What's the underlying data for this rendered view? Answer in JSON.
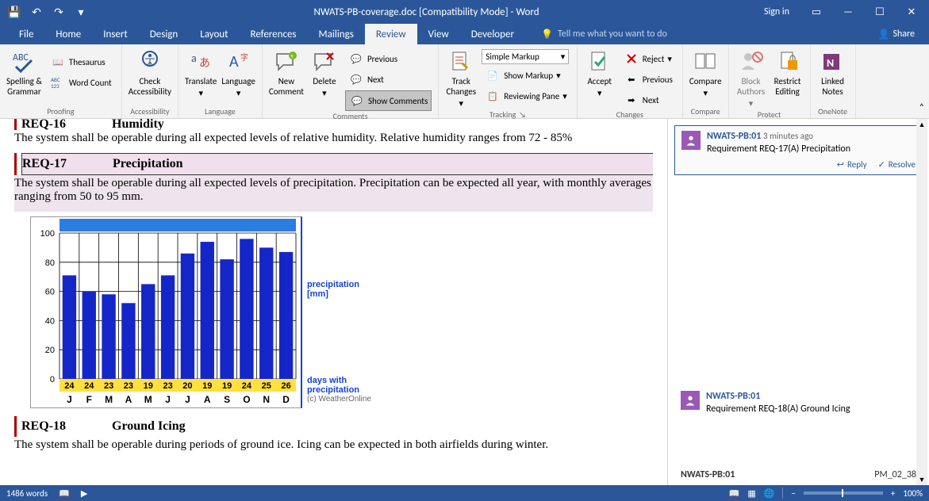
{
  "titlebar": {
    "title": "NWATS-PB-coverage.doc [Compatibility Mode] - Word",
    "signin": "Sign in"
  },
  "tabs": [
    "File",
    "Home",
    "Insert",
    "Design",
    "Layout",
    "References",
    "Mailings",
    "Review",
    "View",
    "Developer"
  ],
  "tellme": "Tell me what you want to do",
  "share": "Share",
  "ribbon": {
    "proofing": {
      "spelling": "Spelling &\nGrammar",
      "thesaurus": "Thesaurus",
      "wordcount": "Word Count",
      "label": "Proofing"
    },
    "accessibility": {
      "check": "Check\nAccessibility",
      "label": "Accessibility"
    },
    "language": {
      "translate": "Translate",
      "language": "Language",
      "label": "Language"
    },
    "comments": {
      "new": "New\nComment",
      "delete": "Delete",
      "previous": "Previous",
      "next": "Next",
      "show": "Show Comments",
      "label": "Comments"
    },
    "tracking": {
      "track": "Track\nChanges",
      "markup": "Simple Markup",
      "showmarkup": "Show Markup",
      "pane": "Reviewing Pane",
      "label": "Tracking"
    },
    "changes": {
      "accept": "Accept",
      "reject": "Reject",
      "previous": "Previous",
      "next": "Next",
      "label": "Changes"
    },
    "compare": {
      "compare": "Compare",
      "label": "Compare"
    },
    "protect": {
      "block": "Block\nAuthors",
      "restrict": "Restrict\nEditing",
      "label": "Protect"
    },
    "onenote": {
      "linked": "Linked\nNotes",
      "label": "OneNote"
    }
  },
  "doc": {
    "req16": {
      "num": "REQ-16",
      "title": "Humidity",
      "body": "The system shall be operable during all expected levels of relative humidity.  Relative humidity ranges from 72 - 85%"
    },
    "req17": {
      "num": "REQ-17",
      "title": "Precipitation",
      "body": "The system shall be operable during all expected levels of precipitation.  Precipitation can be expected all year, with monthly averages ranging from 50 to 95 mm."
    },
    "req18": {
      "num": "REQ-18",
      "title": "Ground Icing",
      "body": "The system shall be operable during periods of ground ice.  Icing can be expected in both airfields during winter."
    }
  },
  "chart_data": {
    "type": "bar",
    "categories": [
      "J",
      "F",
      "M",
      "A",
      "M",
      "J",
      "J",
      "A",
      "S",
      "O",
      "N",
      "D"
    ],
    "values": [
      71,
      60,
      58,
      52,
      65,
      71,
      86,
      94,
      82,
      96,
      90,
      87
    ],
    "days": [
      24,
      24,
      23,
      23,
      19,
      23,
      20,
      19,
      19,
      24,
      25,
      26
    ],
    "ylabel": "precipitation [mm]",
    "ylim": [
      0,
      100
    ],
    "yticks": [
      0,
      20,
      40,
      60,
      80,
      100
    ],
    "legend1": "precipitation",
    "legend1b": "[mm]",
    "legend2": "days with",
    "legend2b": "precipitation",
    "credit": "(c) WeatherOnline"
  },
  "comments": {
    "c1": {
      "author": "NWATS-PB:01",
      "time": "3 minutes ago",
      "text": "Requirement REQ-17(A) Precipitation",
      "reply": "Reply",
      "resolve": "Resolve"
    },
    "c2": {
      "author": "NWATS-PB:01",
      "text": "Requirement REQ-18(A) Ground Icing"
    },
    "c3": {
      "author": "NWATS-PB:01",
      "id": "PM_02_38"
    }
  },
  "status": {
    "words": "1486 words",
    "zoom": "100%"
  }
}
